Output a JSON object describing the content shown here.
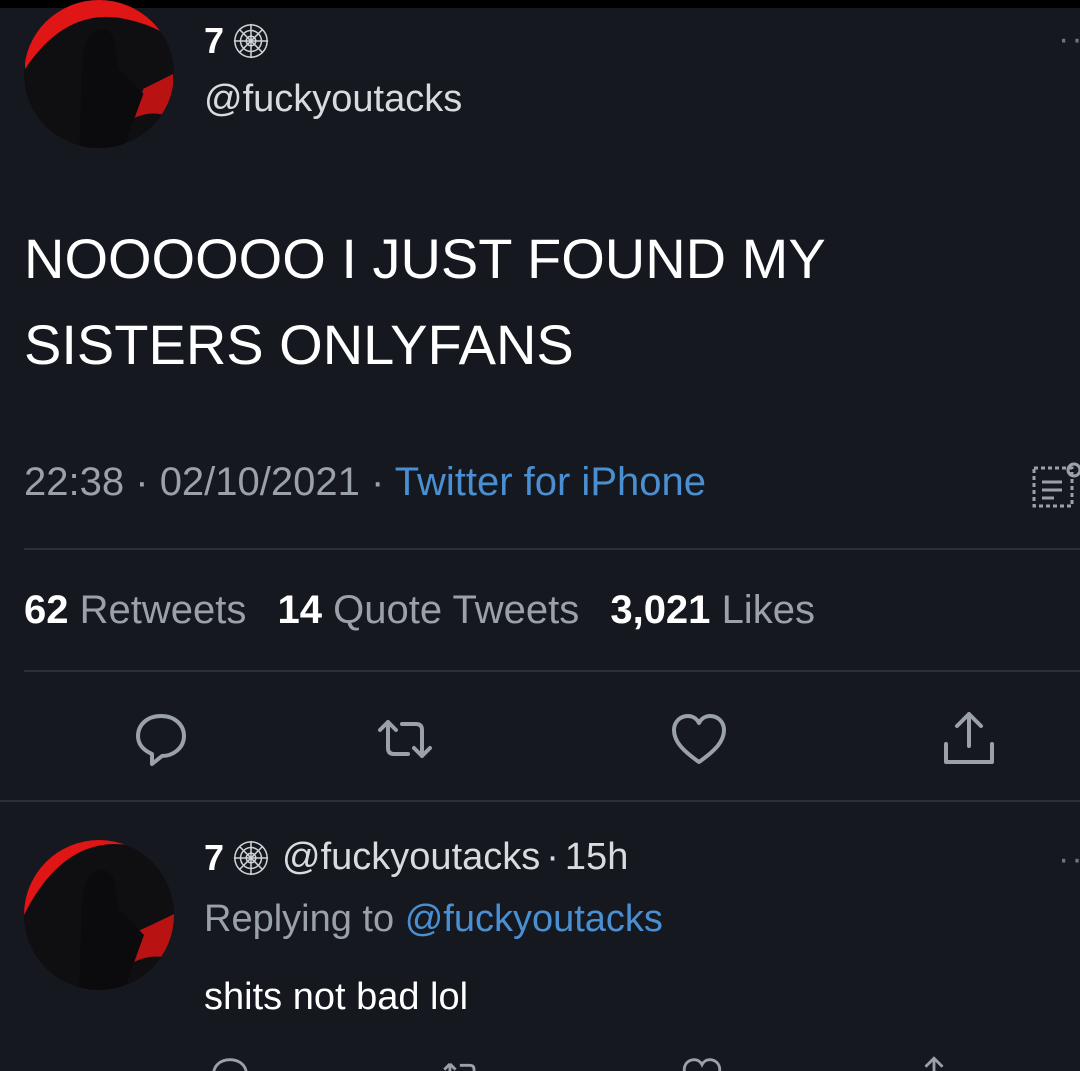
{
  "tweet": {
    "display_name": "7",
    "handle": "@fuckyoutacks",
    "more": "··",
    "text_line1": "NOOOOOO I JUST FOUND MY",
    "text_line2": "SISTERS ONLYFANS",
    "time": "22:38",
    "date": "02/10/2021",
    "sep": "·",
    "source": "Twitter for iPhone",
    "stats": {
      "retweets_count": "62",
      "retweets_label": "Retweets",
      "quotes_count": "14",
      "quotes_label": "Quote Tweets",
      "likes_count": "3,021",
      "likes_label": "Likes"
    }
  },
  "reply": {
    "display_name": "7",
    "handle": "@fuckyoutacks",
    "time": "15h",
    "replying_prefix": "Replying to",
    "replying_to": "@fuckyoutacks",
    "text": "shits not bad lol",
    "more": "··"
  },
  "icons": {
    "name_badge": "spiderweb-icon",
    "analytics": "analytics-icon",
    "reply": "reply-icon",
    "retweet": "retweet-icon",
    "like": "heart-icon",
    "share": "share-icon"
  },
  "colors": {
    "background": "#15181f",
    "link": "#4a8fd1",
    "muted": "#9aa1a8",
    "avatar_red": "#e01515"
  }
}
